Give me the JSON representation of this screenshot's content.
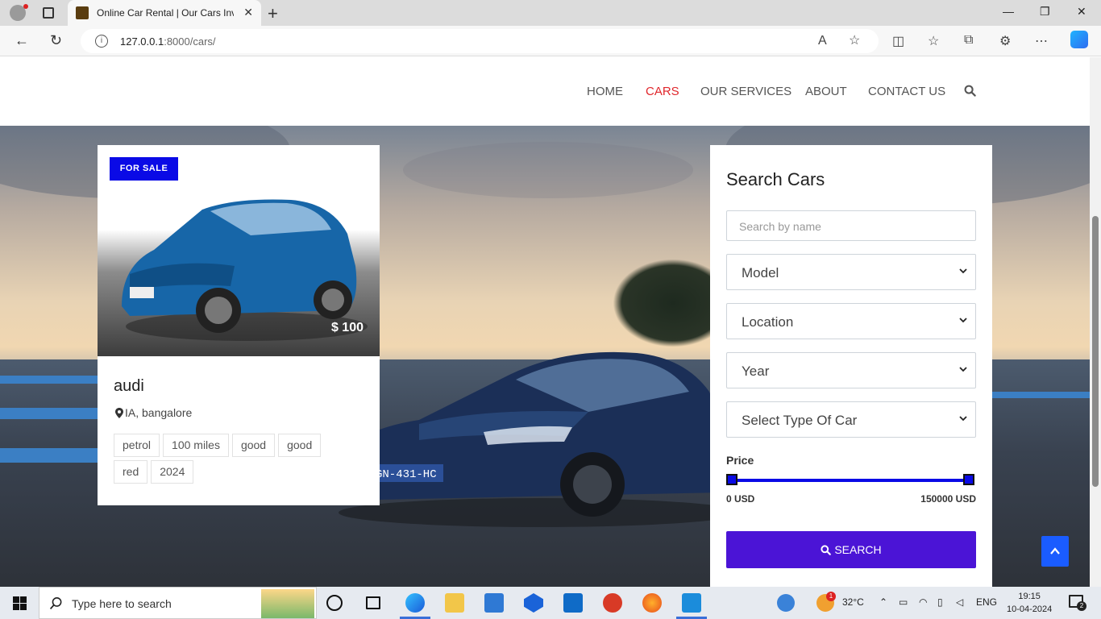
{
  "browser": {
    "tab_title": "Online Car Rental | Our Cars Inve",
    "url_host": "127.0.0.1",
    "url_path": ":8000/cars/"
  },
  "nav": {
    "home": "HOME",
    "cars": "CARS",
    "services": "OUR SERVICES",
    "about": "ABOUT",
    "contact": "CONTACT US"
  },
  "car_card": {
    "badge": "FOR SALE",
    "price": "$ 100",
    "name": "audi",
    "location": "IA, bangalore",
    "tags": [
      "petrol",
      "100 miles",
      "good",
      "good",
      "red",
      "2024"
    ]
  },
  "search_panel": {
    "title": "Search Cars",
    "name_placeholder": "Search by name",
    "selects": [
      "Model",
      "Location",
      "Year",
      "Select Type Of Car"
    ],
    "price_label": "Price",
    "price_min": "0 USD",
    "price_max": "150000 USD",
    "button": "SEARCH"
  },
  "taskbar": {
    "search_text": "Type here to search",
    "temperature": "32°C",
    "language": "ENG",
    "time": "19:15",
    "date": "10-04-2024",
    "weather_badge": "1",
    "notification_count": "2"
  },
  "colors": {
    "accent_red": "#e0262b",
    "badge_blue": "#0a0ae6",
    "button_purple": "#4b14d6"
  }
}
